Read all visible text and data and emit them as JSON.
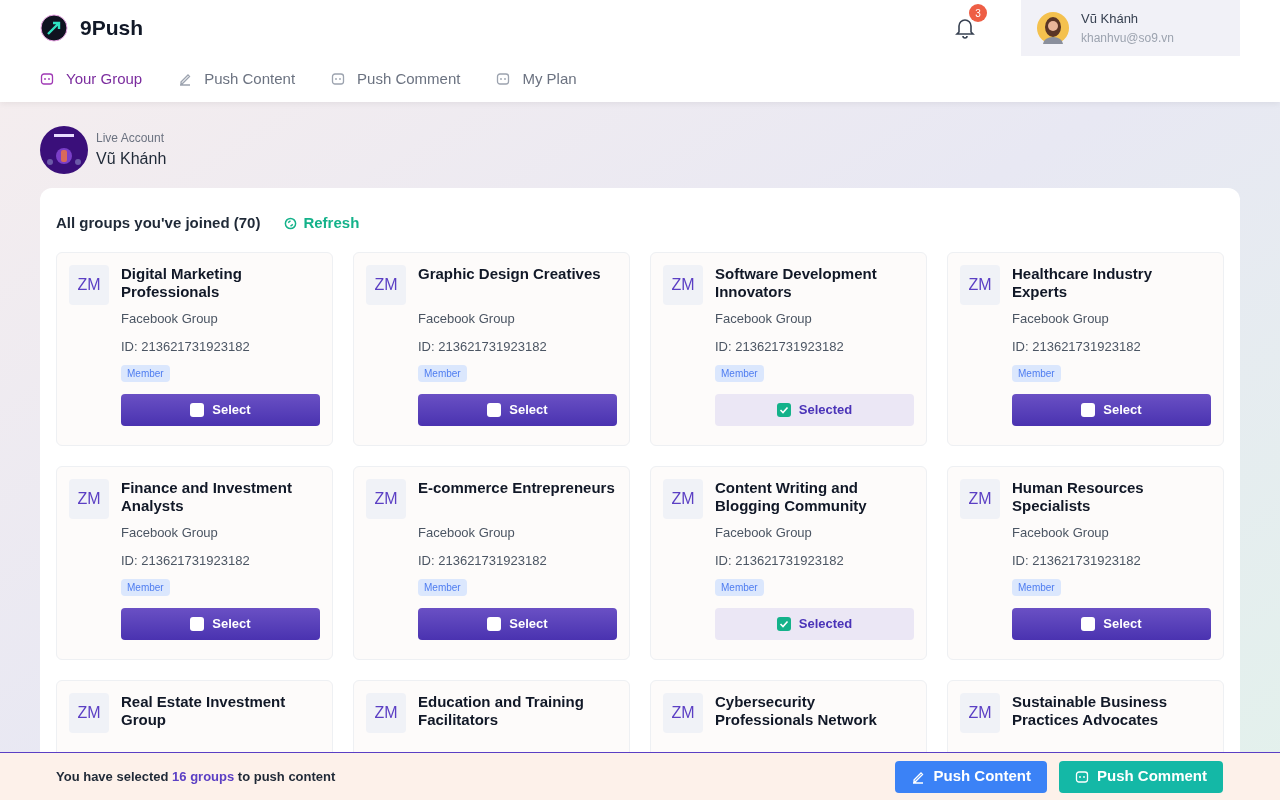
{
  "brand": {
    "name": "9Push"
  },
  "notifications": {
    "count": "3"
  },
  "user": {
    "name": "Vũ Khánh",
    "email": "khanhvu@so9.vn"
  },
  "tabs": [
    {
      "label": "Your Group",
      "kind": "chat",
      "selected": true
    },
    {
      "label": "Push Content",
      "kind": "pen",
      "selected": false
    },
    {
      "label": "Push Comment",
      "kind": "chat",
      "selected": false
    },
    {
      "label": "My Plan",
      "kind": "chat",
      "selected": false
    }
  ],
  "account": {
    "caption": "Live Account",
    "name": "Vũ Khánh"
  },
  "groups_panel": {
    "title": "All groups you've joined (70)",
    "refresh": "Refresh"
  },
  "groups": [
    {
      "initials": "ZM",
      "name": "Digital Marketing Professionals",
      "type": "Facebook Group",
      "id": "ID: 213621731923182",
      "badge": "Member",
      "button": "Select",
      "selected": false
    },
    {
      "initials": "ZM",
      "name": "Graphic Design Creatives",
      "type": "Facebook Group",
      "id": "ID: 213621731923182",
      "badge": "Member",
      "button": "Select",
      "selected": false
    },
    {
      "initials": "ZM",
      "name": "Software Development Innovators",
      "type": "Facebook Group",
      "id": "ID: 213621731923182",
      "badge": "Member",
      "button": "Selected",
      "selected": true
    },
    {
      "initials": "ZM",
      "name": "Healthcare Industry Experts",
      "type": "Facebook Group",
      "id": "ID: 213621731923182",
      "badge": "Member",
      "button": "Select",
      "selected": false
    },
    {
      "initials": "ZM",
      "name": "Finance and Investment Analysts",
      "type": "Facebook Group",
      "id": "ID: 213621731923182",
      "badge": "Member",
      "button": "Select",
      "selected": false
    },
    {
      "initials": "ZM",
      "name": "E-commerce Entrepreneurs",
      "type": "Facebook Group",
      "id": "ID: 213621731923182",
      "badge": "Member",
      "button": "Select",
      "selected": false
    },
    {
      "initials": "ZM",
      "name": "Content Writing and Blogging Community",
      "type": "Facebook Group",
      "id": "ID: 213621731923182",
      "badge": "Member",
      "button": "Selected",
      "selected": true
    },
    {
      "initials": "ZM",
      "name": "Human Resources Specialists",
      "type": "Facebook Group",
      "id": "ID: 213621731923182",
      "badge": "Member",
      "button": "Select",
      "selected": false
    },
    {
      "initials": "ZM",
      "name": "Real Estate Investment Group"
    },
    {
      "initials": "ZM",
      "name": "Education and Training Facilitators"
    },
    {
      "initials": "ZM",
      "name": "Cybersecurity Professionals Network"
    },
    {
      "initials": "ZM",
      "name": "Sustainable Business Practices Advocates"
    }
  ],
  "footer": {
    "message": "You have selected **16 groups** to push content",
    "buttons": [
      {
        "label": "Push Content",
        "kind": "content"
      },
      {
        "label": "Push Comment",
        "kind": "comment"
      }
    ]
  }
}
